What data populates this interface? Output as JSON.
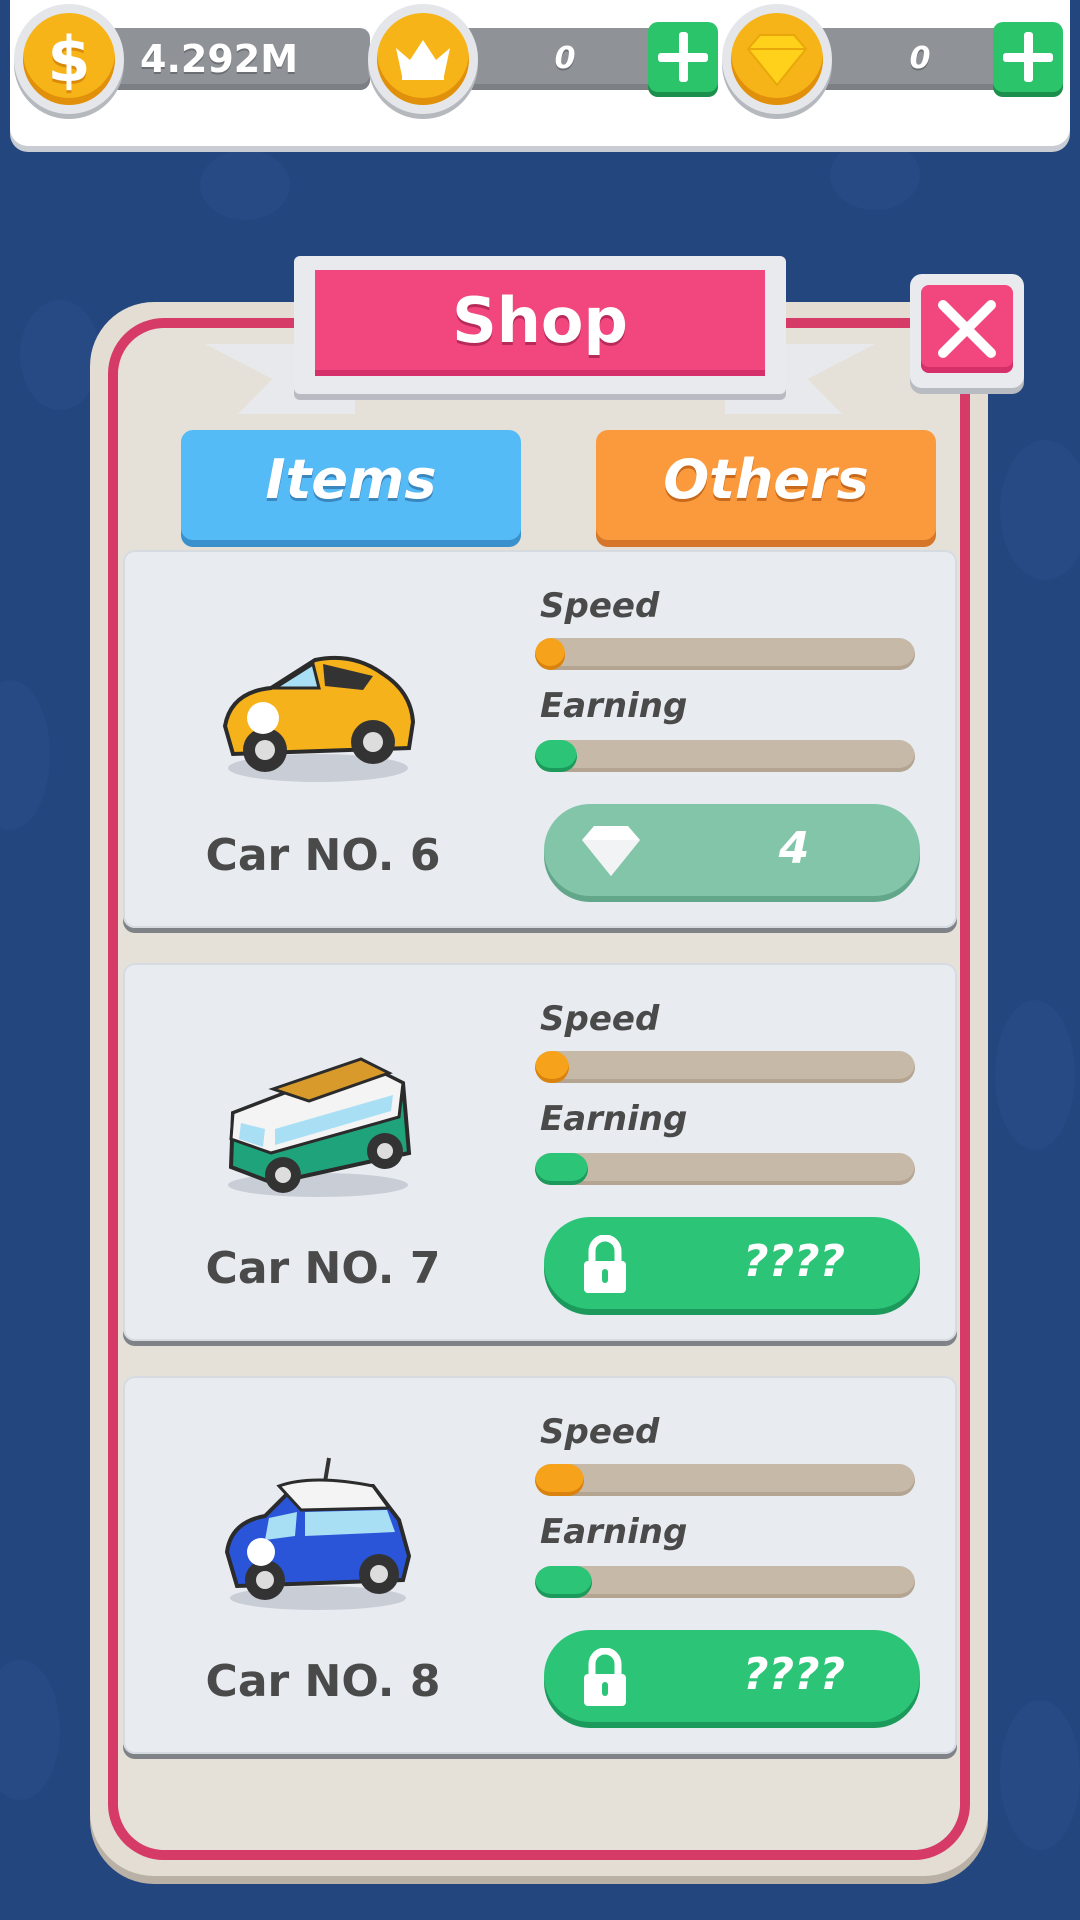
{
  "currencies": {
    "cash": {
      "value": "4.292M",
      "icon": "dollar-coin-icon"
    },
    "crowns": {
      "value": "0",
      "icon": "crown-coin-icon"
    },
    "gems": {
      "value": "0",
      "icon": "diamond-coin-icon"
    }
  },
  "shop": {
    "title": "Shop",
    "tabs": {
      "items": "Items",
      "others": "Others"
    },
    "stat_labels": {
      "speed": "Speed",
      "earning": "Earning"
    },
    "cars": [
      {
        "name": "Car NO. 6",
        "number": "6",
        "color": "#f5b21a",
        "speed_level": 0.08,
        "earning_level": 0.11,
        "price": "4",
        "price_icon": "diamond-icon",
        "locked": false
      },
      {
        "name": "Car NO. 7",
        "number": "7",
        "color": "#1fa37a",
        "speed_level": 0.09,
        "earning_level": 0.14,
        "price": "????",
        "price_icon": "lock-icon",
        "locked": true
      },
      {
        "name": "Car NO. 8",
        "number": "8",
        "color": "#2a55d8",
        "speed_level": 0.13,
        "earning_level": 0.15,
        "price": "????",
        "price_icon": "lock-icon",
        "locked": true
      }
    ]
  },
  "colors": {
    "background": "#24467f",
    "accent_pink": "#f2467e",
    "tab_items": "#55bbf6",
    "tab_others": "#fb9a3c",
    "buy_green": "#2cc477"
  }
}
